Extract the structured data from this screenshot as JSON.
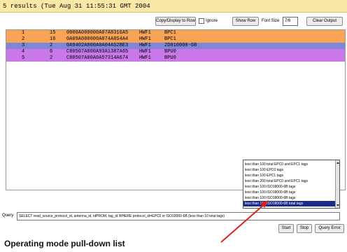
{
  "status_line": "5 results (Tue Aug 31 11:55:31 GMT 2004",
  "toolbar": {
    "copy_display_label": "Copy/Display to Row",
    "ignore_label": "Ignore",
    "show_row_label": "Show Row",
    "font_size_label": "Font Size",
    "font_size_value": "7/6",
    "clear_output_label": "Clear Output"
  },
  "rows": [
    {
      "idx": "1",
      "count": "15",
      "id": "0000A000000A07A8316A5",
      "type": "HWF1",
      "name": "BPC1",
      "color": "orange"
    },
    {
      "idx": "2",
      "count": "16",
      "id": "0A09A000000A074A8S4A4",
      "type": "HWF1",
      "name": "BPC1",
      "color": "orange"
    },
    {
      "idx": "3",
      "count": "2",
      "id": "0A9402A000A0A04AS2BE3",
      "type": "HWF1",
      "name": "2D010000-6B",
      "color": "blue"
    },
    {
      "idx": "4",
      "count": "6",
      "id": "C80507A000A93A1387A65",
      "type": "HWF1",
      "name": "BPU0",
      "color": "purple"
    },
    {
      "idx": "5",
      "count": "2",
      "id": "C80507A00A0A57314A674",
      "type": "HWF1",
      "name": "BPU0",
      "color": "purple"
    }
  ],
  "operating_mode_options": [
    "less than 100 total EPC0 and EPC1 tags",
    "less than 100 EPC0 tags",
    "less than 100 EPC1 tags",
    "less than 200 total EPC0 and EPC1 tags",
    "less than 100 ISO18000-6B tags",
    "less than 100 ISO18000-6B tags",
    "less than 100 ISO18000-6B tags",
    "less than 100 ISO18000-6B total tags"
  ],
  "operating_mode_selected_index": 7,
  "query": {
    "label": "Query",
    "value": "SELECT read_source_protocol_id, antenna_id, idPROM, tag_id WHERE protocol_id=EPC0 or ISO18000-6B (less than 10 total tags)"
  },
  "buttons": {
    "start": "Start",
    "stop": "Stop",
    "query_error": "Query Error"
  },
  "caption": "Operating mode pull-down list",
  "colors": {
    "orange": "#f7a457",
    "blue": "#7f86d8",
    "purple": "#c878e8",
    "status_bg": "#fbe7a6",
    "arrow": "#e02020"
  }
}
